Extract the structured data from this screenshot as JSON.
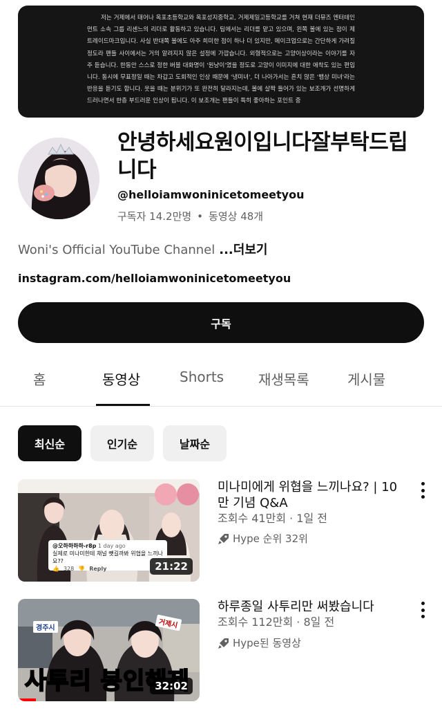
{
  "banner": {
    "text": "저는 거제에서 태어나 옥포초등학교와 옥포성지중학교, 거제제일고등학교를 거쳐 현재 더뮤즈 엔터테인먼트 소속 그룹 리센느의 리더로 활동하고 있습니다. 팀에서는 리더를 맡고 있으며, 왼쪽 볼에 있는 점이 제 트레이드마크입니다. 사실 반대쪽 볼에도 아주 희미한 점이 하나 더 있지만, 메이크업으로는 간단하게 가려질 정도라 팬들 사이에서는 거의 알려지지 않은 설정에 가깝습니다. 외형적으로는 고양이상이라는 이야기를 자주 듣습니다. 한동안 스스로 정한 버블 대화명이 '원냥이'였을 정도로 고양이 이미지에 대한 애착도 있는 편입니다. 동시에 무표정일 때는 차갑고 도회적인 인상 때문에 '냉미녀', 더 나아가서는 흔치 않은 '뱀상 미녀'라는 반응을 듣기도 합니다. 웃을 때는 분위기가 또 완전히 달라지는데, 볼에 살짝 들어가 있는 보조개가 선명하게 드러나면서 한층 부드러운 인상이 됩니다. 이 보조개는 팬들이 특히 좋아하는 포인트 중"
  },
  "channel": {
    "name": "안녕하세요원이입니다잘부탁드립니다",
    "handle": "@helloiamwoninicetomeetyou",
    "subscribers": "구독자 14.2만명",
    "separator": "•",
    "video_count": "동영상 48개",
    "description": "Woni's Official YouTube Channel",
    "more_label": "...더보기",
    "link": "instagram.com/helloiamwoninicetomeetyou",
    "subscribe_label": "구독"
  },
  "tabs": [
    {
      "label": "홈",
      "active": false
    },
    {
      "label": "동영상",
      "active": true
    },
    {
      "label": "Shorts",
      "active": false
    },
    {
      "label": "재생목록",
      "active": false
    },
    {
      "label": "게시물",
      "active": false
    }
  ],
  "chips": [
    {
      "label": "최신순",
      "selected": true
    },
    {
      "label": "인기순",
      "selected": false
    },
    {
      "label": "날짜순",
      "selected": false
    }
  ],
  "videos": [
    {
      "title": "미나미에게 위협을 느끼나요? | 10만 기념 Q&A",
      "meta": "조회수 41만회 · 1일 전",
      "badge": "Hype 순위 32위",
      "duration": "21:22",
      "comment_user": "@오하하하하-r8p",
      "comment_time": "1 day ago",
      "comment_text": "실제로 미나미한테 채널 뺏길까봐 위협을 느끼나요??",
      "comment_likes": "328",
      "comment_reply": "Reply"
    },
    {
      "title": "하루종일 사투리만 써봤습니다",
      "meta": "조회수 112만회 · 8일 전",
      "badge": "Hype된 동영상",
      "duration": "32:02",
      "sign_left": "경주시",
      "sign_right": "거제시",
      "caption": "사투리 봉인해제"
    }
  ],
  "colors": {
    "accent": "#0f0f0f",
    "secondary_text": "#606060",
    "chip_bg": "#f0f0f0",
    "progress": "#ff0000"
  },
  "icons": {
    "more": "kebab-vertical-icon",
    "hype": "hype-rocket-icon",
    "like": "thumbs-up-icon",
    "dislike": "thumbs-down-icon"
  }
}
